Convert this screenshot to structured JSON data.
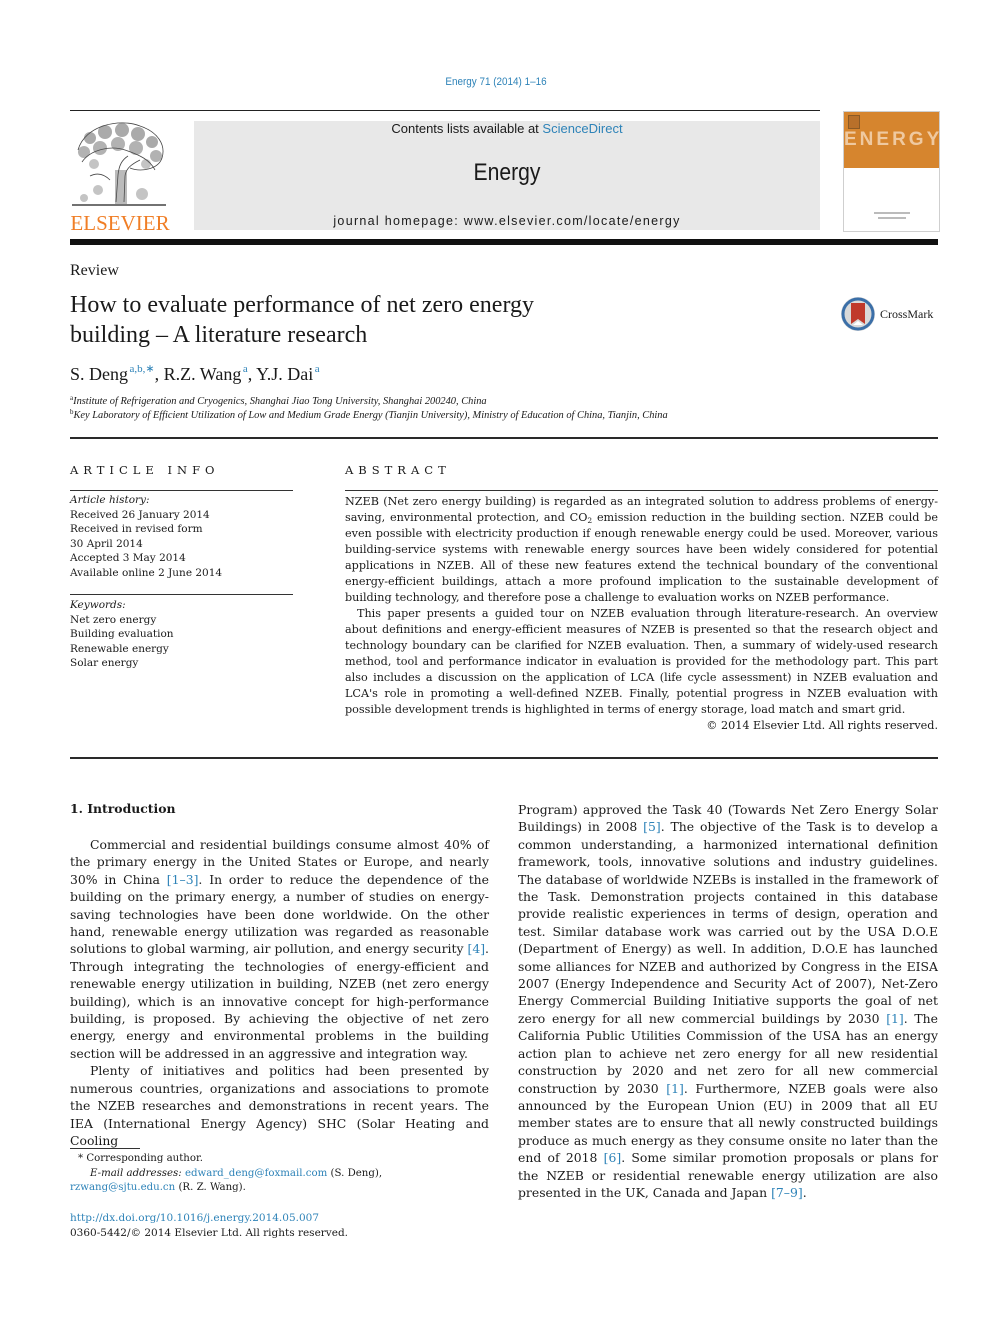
{
  "running_header": {
    "journal_ref": "Energy 71 (2014) 1–16"
  },
  "masthead": {
    "publisher_logo_text": "ELSEVIER",
    "contents_prefix": "Contents lists available at ",
    "contents_link": "ScienceDirect",
    "journal_name": "Energy",
    "homepage": "journal homepage: www.elsevier.com/locate/energy",
    "cover_title": "ENERGY",
    "brand_color": "#f07e26",
    "link_color": "#2e83b8"
  },
  "article": {
    "type": "Review",
    "title_line1": "How to evaluate performance of net zero energy",
    "title_line2": "building – A literature research",
    "crossmark_label": "CrossMark",
    "authors": [
      {
        "name": "S. Deng",
        "sup": "a,b,∗"
      },
      {
        "name": "R.Z. Wang",
        "sup": "a"
      },
      {
        "name": "Y.J. Dai",
        "sup": "a"
      }
    ],
    "author_separator": ", ",
    "affiliations": [
      {
        "key": "a",
        "text": "Institute of Refrigeration and Cryogenics, Shanghai Jiao Tong University, Shanghai 200240, China"
      },
      {
        "key": "b",
        "text": "Key Laboratory of Efficient Utilization of Low and Medium Grade Energy (Tianjin University), Ministry of Education of China, Tianjin, China"
      }
    ]
  },
  "article_info": {
    "heading": "ARTICLE INFO",
    "history_label": "Article history:",
    "history": [
      "Received 26 January 2014",
      "Received in revised form",
      "30 April 2014",
      "Accepted 3 May 2014",
      "Available online 2 June 2014"
    ],
    "keywords_label": "Keywords:",
    "keywords": [
      "Net zero energy",
      "Building evaluation",
      "Renewable energy",
      "Solar energy"
    ]
  },
  "abstract": {
    "heading": "ABSTRACT",
    "p1_a": "NZEB (Net zero energy building) is regarded as an integrated solution to address problems of energy-saving, environmental protection, and CO",
    "p1_sub": "2",
    "p1_b": " emission reduction in the building section. NZEB could be even possible with electricity production if enough renewable energy could be used. Moreover, various building-service systems with renewable energy sources have been widely considered for potential applications in NZEB. All of these new features extend the technical boundary of the conventional energy-efficient buildings, attach a more profound implication to the sustainable development of building technology, and therefore pose a challenge to evaluation works on NZEB performance.",
    "p2": "This paper presents a guided tour on NZEB evaluation through literature-research. An overview about definitions and energy-efficient measures of NZEB is presented so that the research object and tech­nology boundary can be clarified for NZEB evaluation. Then, a summary of widely-used research method, tool and performance indicator in evaluation is provided for the methodology part. This part also in­cludes a discussion on the application of LCA (life cycle assessment) in NZEB evaluation and LCA's role in promoting a well-defined NZEB. Finally, potential progress in NZEB evaluation with possible develop­ment trends is highlighted in terms of energy storage, load match and smart grid.",
    "copyright": "© 2014 Elsevier Ltd. All rights reserved."
  },
  "body": {
    "section_heading": "1.  Introduction",
    "left_p1_a": "Commercial and residential buildings consume almost 40% of the primary energy in the United States or Europe, and nearly 30% in China ",
    "left_p1_ref1": "[1–3]",
    "left_p1_b": ". In order to reduce the dependence of the building on the primary energy, a number of studies on energy-saving technologies have been done worldwide. On the other hand, renewable energy utilization was regarded as reasonable solutions to global warming, air pollution, and energy security ",
    "left_p1_ref2": "[4]",
    "left_p1_c": ". Through integrating the technologies of energy-efficient and renewable energy utilization in building, NZEB (net zero energy building), which is an innovative concept for high-performance building, is proposed. By achieving the objective of net zero energy, energy and environmental problems in the building section will be addressed in an aggressive and integration way.",
    "left_p2": "Plenty of initiatives and politics had been presented by numerous countries, organizations and associations to promote the NZEB researches and demonstrations in recent years. The IEA (In­ternational Energy Agency) SHC (Solar Heating and Cooling",
    "right_a": "Program) approved the Task 40 (Towards Net Zero Energy Solar Buildings) in 2008 ",
    "right_ref1": "[5]",
    "right_b": ". The objective of the Task is to develop a common understanding, a harmonized international definition framework, tools, innovative solutions and industry guidelines. The database of worldwide NZEBs is installed in the framework of the Task. Demonstration projects contained in this database provide realistic experiences in terms of design, operation and test. Similar database work was carried out by the USA D.O.E (Department of Energy) as well. In addition, D.O.E has launched some alliances for NZEB and authorized by Congress in the EISA 2007 (Energy Inde­pendence and Security Act of 2007), Net-Zero Energy Commercial Building Initiative supports the goal of net zero energy for all new commercial buildings by 2030 ",
    "right_ref2": "[1]",
    "right_c": ". The California Public Utilities Commission of the USA has an energy action plan to achieve net zero energy for all new residential construction by 2020 and net zero for all new commercial construction by 2030 ",
    "right_ref3": "[1]",
    "right_d": ". Furthermore, NZEB goals were also announced by the European Union (EU) in 2009 that all EU member states are to ensure that all newly con­structed buildings produce as much energy as they consume on­site no later than the end of 2018 ",
    "right_ref4": "[6]",
    "right_e": ". Some similar promotion proposals or plans for the NZEB or residential renewable energy utilization are also presented in the UK, Canada and Japan ",
    "right_ref5": "[7–9]",
    "right_f": "."
  },
  "footnotes": {
    "corresponding_mark": "*",
    "corresponding": " Corresponding author.",
    "email_label": "E-mail addresses:",
    "email1": "edward_deng@foxmail.com",
    "email1_owner": " (S. Deng), ",
    "email2": "rzwang@sjtu.edu.cn",
    "email2_owner": " (R. Z. Wang).",
    "doi": "http://dx.doi.org/10.1016/j.energy.2014.05.007",
    "issn_copyright": "0360-5442/© 2014 Elsevier Ltd. All rights reserved."
  }
}
